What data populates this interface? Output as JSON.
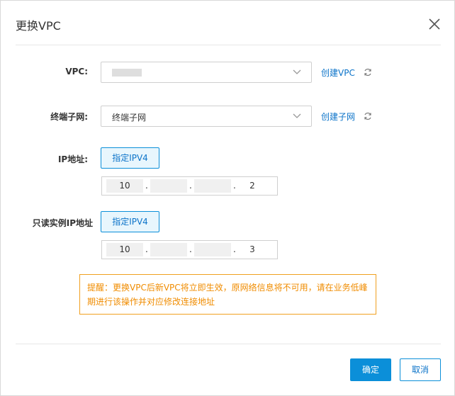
{
  "dialog": {
    "title": "更换VPC",
    "close_icon": "close-icon"
  },
  "form": {
    "vpc": {
      "label": "VPC:",
      "value": "",
      "create_link": "创建VPC",
      "refresh_icon": "refresh-icon"
    },
    "terminal_subnet": {
      "label": "终端子网:",
      "value": "终端子网",
      "create_link": "创建子网",
      "refresh_icon": "refresh-icon"
    },
    "ip_address": {
      "label": "IP地址:",
      "button": "指定IPV4",
      "octets": [
        "10",
        "",
        "",
        "2"
      ]
    },
    "readonly_ip": {
      "label": "只读实例IP地址",
      "button": "指定IPV4",
      "octets": [
        "10",
        "",
        "",
        "3"
      ]
    }
  },
  "notice": {
    "text": "提醒：更换VPC后新VPC将立即生效，原网络信息将不可用，请在业务低峰期进行该操作并对应修改连接地址"
  },
  "footer": {
    "confirm": "确定",
    "cancel": "取消"
  },
  "colors": {
    "primary": "#0b8fd9",
    "link": "#0b73c9",
    "warning": "#f08c00"
  }
}
